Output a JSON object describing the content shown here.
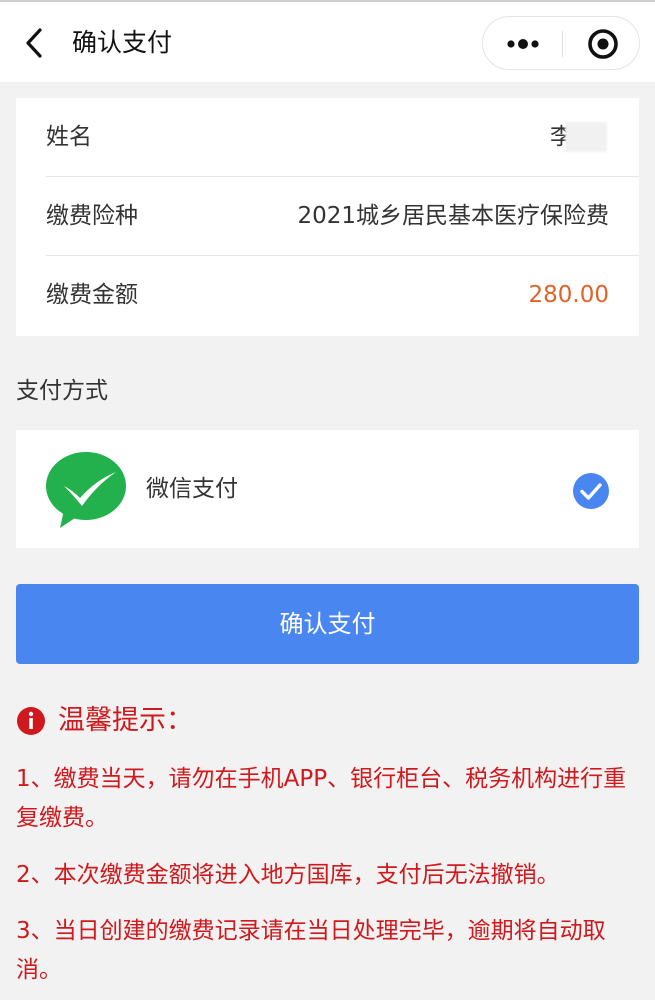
{
  "nav": {
    "title": "确认支付",
    "back_icon": "chevron-left-icon",
    "more_icon": "more-dots-icon",
    "close_icon": "target-close-icon"
  },
  "info": {
    "rows": [
      {
        "label": "姓名",
        "value": "李"
      },
      {
        "label": "缴费险种",
        "value": "2021城乡居民基本医疗保险费"
      },
      {
        "label": "缴费金额",
        "value": "280.00"
      }
    ]
  },
  "payment": {
    "section_title": "支付方式",
    "method_label": "微信支付",
    "method_icon": "wechat-pay-icon",
    "selected": true,
    "check_icon": "check-circle-icon"
  },
  "confirm_button": {
    "label": "确认支付"
  },
  "tips": {
    "title": "温馨提示：",
    "icon": "info-circle-icon",
    "items": [
      "1、缴费当天，请勿在手机APP、银行柜台、税务机构进行重复缴费。",
      "2、本次缴费金额将进入地方国库，支付后无法撤销。",
      "3、当日创建的缴费记录请在当日处理完毕，逾期将自动取消。"
    ]
  },
  "colors": {
    "accent_blue": "#4a86f0",
    "amount_orange": "#e0632a",
    "warning_red": "#d0191d",
    "wechat_green": "#22b14c"
  }
}
